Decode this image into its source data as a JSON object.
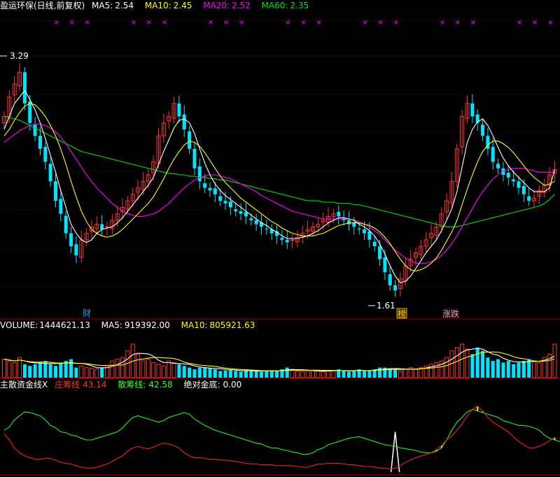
{
  "header": {
    "title": "盈运环保(日线,前复权)",
    "ma5_label": "MA5:",
    "ma5_value": "2.54",
    "ma10_label": "MA10:",
    "ma10_value": "2.45",
    "ma20_label": "MA20:",
    "ma20_value": "2.52",
    "ma60_label": "MA60:",
    "ma60_value": "2.35"
  },
  "price_panel": {
    "high_label": "3.29",
    "low_label": "1.61",
    "badges": [
      "财",
      "榜",
      "涨跌"
    ],
    "marker_glyph": "×",
    "colors": {
      "up": "#ff3232",
      "down": "#00e5ff",
      "ma5": "#ffffff",
      "ma10": "#ffff00",
      "ma20": "#ff00ff",
      "ma60": "#00e000",
      "grid": "#7a0000"
    }
  },
  "volume_panel": {
    "label": "VOLUME:",
    "value": "1444621.13",
    "ma5_label": "MA5:",
    "ma5_value": "919392.00",
    "ma10_label": "MA10:",
    "ma10_value": "805921.63"
  },
  "indicator_panel": {
    "title": "主散资金线X",
    "zhuang_label": "庄筹线",
    "zhuang_value": "43.14",
    "san_label": "散筹线:",
    "san_value": "42.58",
    "jd_label": "绝对金底:",
    "jd_value": "0.00"
  },
  "chart_data": {
    "type": "candlestick",
    "closes": [
      2.95,
      3.1,
      3.2,
      3.29,
      3.05,
      2.9,
      2.8,
      2.7,
      2.6,
      2.45,
      2.3,
      2.2,
      2.05,
      1.95,
      1.88,
      2.0,
      2.05,
      2.1,
      2.12,
      2.08,
      2.1,
      2.15,
      2.2,
      2.25,
      2.3,
      2.35,
      2.4,
      2.45,
      2.5,
      2.6,
      2.8,
      2.9,
      2.95,
      3.05,
      2.95,
      2.85,
      2.7,
      2.55,
      2.45,
      2.4,
      2.38,
      2.35,
      2.3,
      2.28,
      2.25,
      2.22,
      2.2,
      2.18,
      2.15,
      2.12,
      2.1,
      2.08,
      2.05,
      2.03,
      2.0,
      1.98,
      2.0,
      2.02,
      2.05,
      2.08,
      2.1,
      2.12,
      2.15,
      2.18,
      2.2,
      2.18,
      2.15,
      2.12,
      2.1,
      2.08,
      2.05,
      2.0,
      1.95,
      1.85,
      1.75,
      1.65,
      1.61,
      1.7,
      1.8,
      1.85,
      1.9,
      1.95,
      2.0,
      2.05,
      2.1,
      2.2,
      2.3,
      2.45,
      2.7,
      2.95,
      3.05,
      2.95,
      2.9,
      2.8,
      2.7,
      2.6,
      2.55,
      2.5,
      2.48,
      2.45,
      2.4,
      2.35,
      2.3,
      2.32,
      2.38,
      2.42,
      2.5,
      2.54
    ],
    "ma5": [
      2.85,
      2.95,
      3.05,
      3.1,
      3.15,
      3.08,
      3.0,
      2.9,
      2.78,
      2.65,
      2.52,
      2.38,
      2.25,
      2.12,
      2.05,
      2.0,
      1.98,
      2.0,
      2.05,
      2.08,
      2.09,
      2.1,
      2.13,
      2.17,
      2.22,
      2.27,
      2.32,
      2.37,
      2.42,
      2.48,
      2.58,
      2.68,
      2.77,
      2.86,
      2.92,
      2.93,
      2.9,
      2.82,
      2.7,
      2.59,
      2.5,
      2.43,
      2.38,
      2.34,
      2.31,
      2.28,
      2.25,
      2.22,
      2.19,
      2.16,
      2.13,
      2.11,
      2.08,
      2.06,
      2.03,
      2.01,
      2.01,
      2.01,
      2.02,
      2.03,
      2.05,
      2.07,
      2.1,
      2.13,
      2.15,
      2.17,
      2.17,
      2.16,
      2.15,
      2.12,
      2.1,
      2.07,
      2.03,
      1.97,
      1.89,
      1.8,
      1.72,
      1.67,
      1.68,
      1.72,
      1.78,
      1.84,
      1.9,
      1.95,
      2.0,
      2.07,
      2.15,
      2.24,
      2.37,
      2.56,
      2.75,
      2.85,
      2.91,
      2.93,
      2.88,
      2.8,
      2.71,
      2.63,
      2.57,
      2.52,
      2.48,
      2.44,
      2.4,
      2.37,
      2.37,
      2.37,
      2.4,
      2.54
    ],
    "ma10": [
      2.8,
      2.85,
      2.92,
      2.98,
      3.03,
      3.05,
      3.04,
      3.0,
      2.95,
      2.88,
      2.8,
      2.7,
      2.58,
      2.45,
      2.33,
      2.22,
      2.14,
      2.08,
      2.05,
      2.03,
      2.02,
      2.03,
      2.05,
      2.08,
      2.12,
      2.16,
      2.2,
      2.24,
      2.28,
      2.33,
      2.4,
      2.47,
      2.55,
      2.62,
      2.68,
      2.73,
      2.76,
      2.75,
      2.72,
      2.67,
      2.61,
      2.55,
      2.49,
      2.44,
      2.4,
      2.36,
      2.32,
      2.29,
      2.26,
      2.23,
      2.2,
      2.17,
      2.14,
      2.12,
      2.09,
      2.07,
      2.05,
      2.04,
      2.03,
      2.03,
      2.03,
      2.04,
      2.05,
      2.07,
      2.09,
      2.11,
      2.12,
      2.13,
      2.13,
      2.13,
      2.12,
      2.11,
      2.09,
      2.06,
      2.02,
      1.97,
      1.91,
      1.85,
      1.8,
      1.77,
      1.76,
      1.77,
      1.79,
      1.82,
      1.86,
      1.92,
      1.99,
      2.06,
      2.15,
      2.27,
      2.39,
      2.5,
      2.6,
      2.68,
      2.73,
      2.76,
      2.76,
      2.74,
      2.71,
      2.67,
      2.62,
      2.57,
      2.52,
      2.48,
      2.45,
      2.42,
      2.43,
      2.45
    ],
    "ma20": [
      2.75,
      2.78,
      2.81,
      2.84,
      2.86,
      2.88,
      2.89,
      2.89,
      2.88,
      2.86,
      2.83,
      2.79,
      2.74,
      2.68,
      2.62,
      2.56,
      2.5,
      2.45,
      2.4,
      2.36,
      2.32,
      2.28,
      2.25,
      2.22,
      2.2,
      2.19,
      2.18,
      2.18,
      2.19,
      2.2,
      2.22,
      2.25,
      2.28,
      2.32,
      2.36,
      2.4,
      2.43,
      2.46,
      2.48,
      2.49,
      2.5,
      2.5,
      2.49,
      2.48,
      2.47,
      2.45,
      2.43,
      2.41,
      2.39,
      2.37,
      2.34,
      2.32,
      2.3,
      2.28,
      2.26,
      2.24,
      2.22,
      2.21,
      2.2,
      2.19,
      2.18,
      2.17,
      2.16,
      2.16,
      2.16,
      2.16,
      2.16,
      2.16,
      2.15,
      2.14,
      2.12,
      2.1,
      2.07,
      2.04,
      2.0,
      1.96,
      1.92,
      1.89,
      1.86,
      1.84,
      1.82,
      1.82,
      1.82,
      1.83,
      1.85,
      1.88,
      1.92,
      1.97,
      2.03,
      2.1,
      2.17,
      2.24,
      2.31,
      2.37,
      2.42,
      2.47,
      2.5,
      2.53,
      2.54,
      2.55,
      2.55,
      2.55,
      2.54,
      2.53,
      2.52,
      2.52,
      2.52,
      2.52
    ],
    "ma60": [
      2.95,
      2.94,
      2.93,
      2.92,
      2.9,
      2.88,
      2.86,
      2.84,
      2.82,
      2.8,
      2.78,
      2.76,
      2.74,
      2.72,
      2.7,
      2.68,
      2.67,
      2.66,
      2.65,
      2.64,
      2.63,
      2.62,
      2.61,
      2.6,
      2.59,
      2.58,
      2.57,
      2.56,
      2.55,
      2.54,
      2.53,
      2.52,
      2.51,
      2.51,
      2.5,
      2.5,
      2.49,
      2.49,
      2.48,
      2.48,
      2.47,
      2.47,
      2.46,
      2.46,
      2.45,
      2.44,
      2.43,
      2.42,
      2.41,
      2.4,
      2.39,
      2.38,
      2.37,
      2.36,
      2.35,
      2.34,
      2.33,
      2.32,
      2.31,
      2.3,
      2.3,
      2.3,
      2.29,
      2.29,
      2.29,
      2.28,
      2.28,
      2.28,
      2.27,
      2.27,
      2.26,
      2.25,
      2.24,
      2.23,
      2.22,
      2.21,
      2.2,
      2.19,
      2.18,
      2.17,
      2.16,
      2.15,
      2.14,
      2.13,
      2.12,
      2.11,
      2.1,
      2.1,
      2.1,
      2.11,
      2.12,
      2.13,
      2.14,
      2.15,
      2.16,
      2.17,
      2.18,
      2.19,
      2.2,
      2.21,
      2.22,
      2.23,
      2.24,
      2.25,
      2.26,
      2.28,
      2.31,
      2.35
    ],
    "volume": [
      0.55,
      0.5,
      0.45,
      0.6,
      0.4,
      0.35,
      0.4,
      0.45,
      0.5,
      0.4,
      0.35,
      0.45,
      0.5,
      0.55,
      0.3,
      0.35,
      0.3,
      0.28,
      0.25,
      0.3,
      0.35,
      0.5,
      0.55,
      0.6,
      0.8,
      1.0,
      0.7,
      0.5,
      0.55,
      0.45,
      0.4,
      0.35,
      0.5,
      0.45,
      0.4,
      0.35,
      0.3,
      0.25,
      0.3,
      0.3,
      0.28,
      0.25,
      0.2,
      0.22,
      0.25,
      0.2,
      0.18,
      0.2,
      0.22,
      0.2,
      0.18,
      0.2,
      0.22,
      0.2,
      0.25,
      0.3,
      0.25,
      0.2,
      0.18,
      0.2,
      0.22,
      0.2,
      0.18,
      0.2,
      0.22,
      0.25,
      0.2,
      0.18,
      0.2,
      0.25,
      0.22,
      0.2,
      0.25,
      0.3,
      0.3,
      0.28,
      0.25,
      0.2,
      0.25,
      0.3,
      0.25,
      0.3,
      0.35,
      0.4,
      0.45,
      0.5,
      0.6,
      0.8,
      0.9,
      1.0,
      0.85,
      0.7,
      0.9,
      0.8,
      0.6,
      0.5,
      0.55,
      0.45,
      0.5,
      0.4,
      0.45,
      0.5,
      0.55,
      0.5,
      0.45,
      0.6,
      0.7,
      1.0
    ],
    "zhuang": [
      48,
      40,
      30,
      24,
      20,
      18,
      16,
      16,
      17,
      17,
      15,
      12,
      11,
      10,
      8,
      6,
      5,
      5,
      6,
      8,
      10,
      13,
      17,
      20,
      26,
      30,
      32,
      30,
      29,
      31,
      34,
      36,
      35,
      33,
      30,
      24,
      20,
      18,
      18,
      17,
      16,
      16,
      15,
      15,
      14,
      13,
      12,
      11,
      10,
      10,
      9,
      9,
      9,
      8,
      8,
      8,
      8,
      7,
      6,
      6,
      8,
      10,
      10,
      11,
      11,
      11,
      10,
      9,
      9,
      8,
      7,
      7,
      6,
      5,
      5,
      4,
      5,
      8,
      12,
      15,
      18,
      20,
      22,
      24,
      28,
      33,
      40,
      45,
      52,
      60,
      70,
      78,
      82,
      76,
      68,
      62,
      58,
      54,
      50,
      44,
      38,
      34,
      30,
      30,
      32,
      35,
      39,
      43
    ],
    "san": [
      52,
      56,
      65,
      70,
      75,
      74,
      72,
      70,
      65,
      58,
      55,
      50,
      49,
      46,
      45,
      42,
      40,
      40,
      42,
      44,
      46,
      48,
      50,
      55,
      62,
      68,
      70,
      68,
      66,
      64,
      62,
      64,
      68,
      70,
      72,
      74,
      72,
      66,
      62,
      58,
      55,
      52,
      50,
      48,
      46,
      44,
      42,
      40,
      38,
      36,
      35,
      32,
      30,
      30,
      28,
      27,
      25,
      24,
      22,
      22,
      24,
      28,
      30,
      34,
      36,
      38,
      40,
      42,
      43,
      44,
      42,
      40,
      38,
      36,
      34,
      33,
      32,
      30,
      29,
      28,
      27,
      25,
      24,
      24,
      26,
      30,
      40,
      52,
      62,
      68,
      75,
      78,
      76,
      74,
      72,
      70,
      68,
      64,
      62,
      60,
      58,
      58,
      57,
      55,
      52,
      46,
      42,
      40,
      38,
      38,
      42
    ]
  }
}
